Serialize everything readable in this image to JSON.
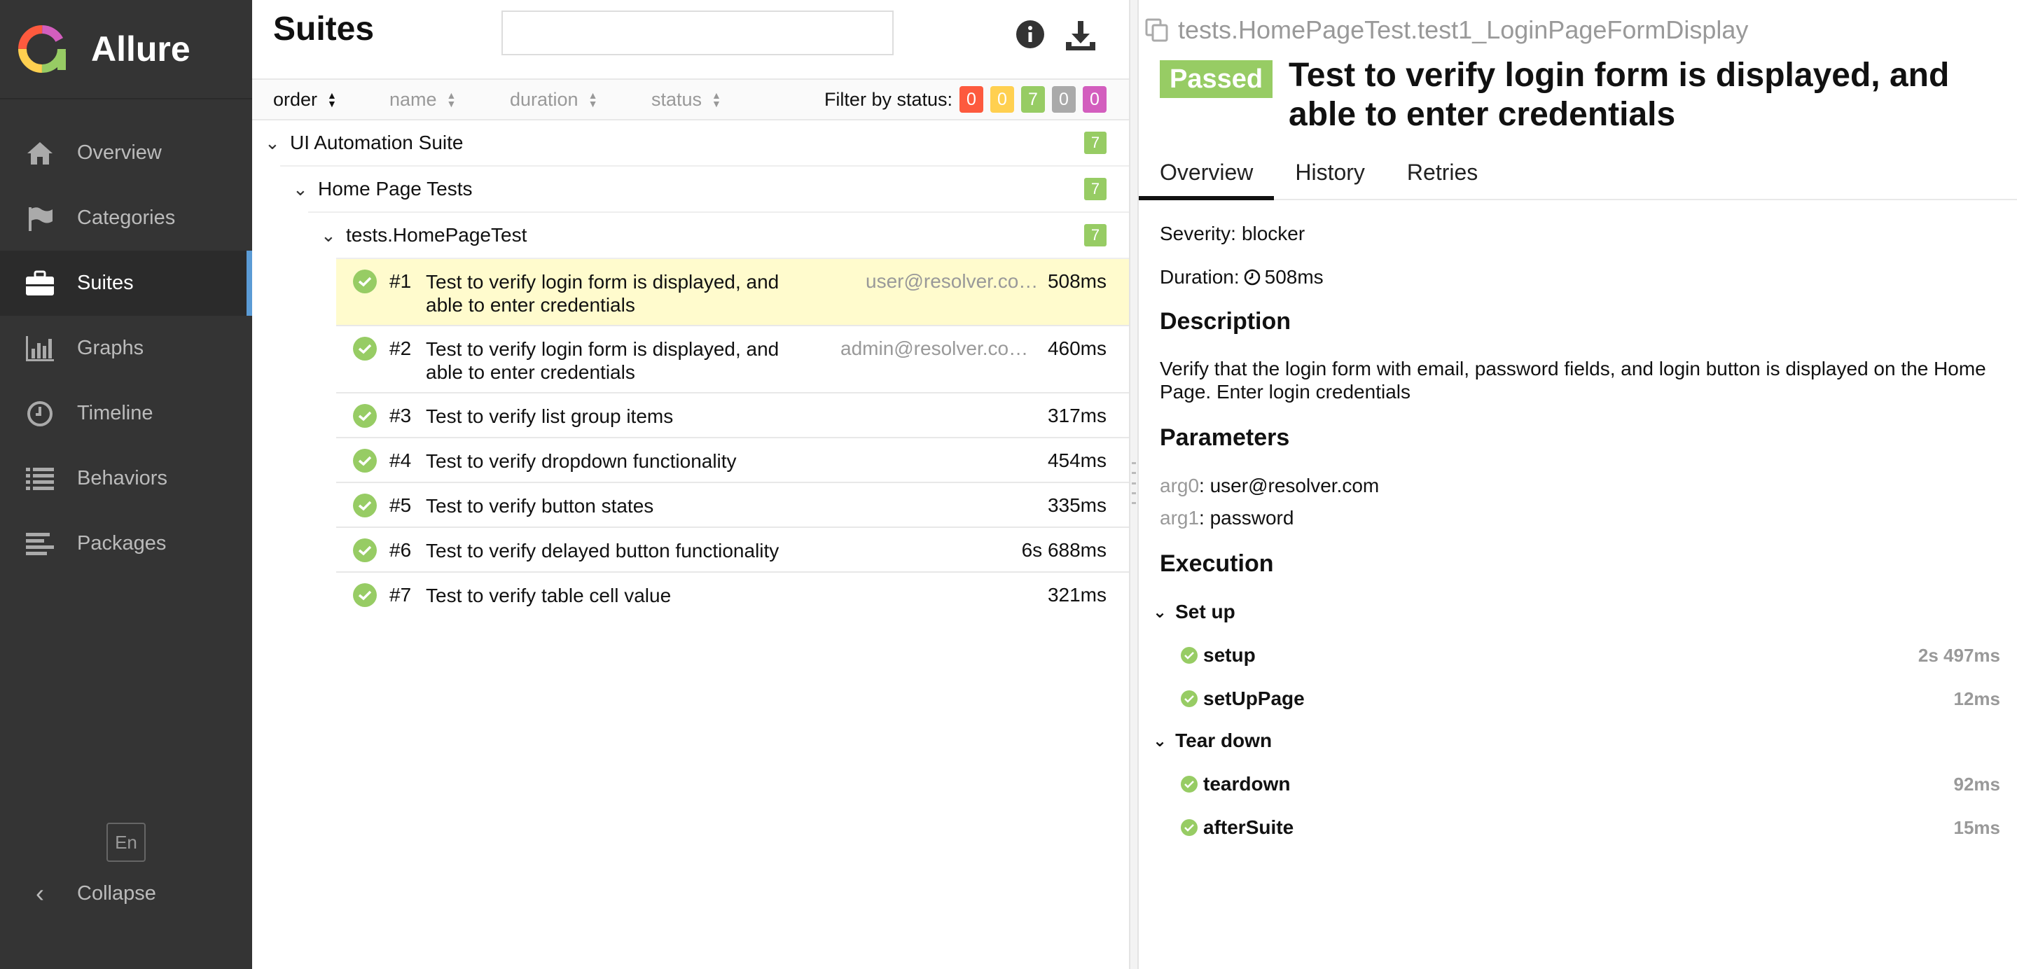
{
  "app": {
    "name": "Allure"
  },
  "sidebar": {
    "items": [
      {
        "label": "Overview",
        "icon": "home-icon"
      },
      {
        "label": "Categories",
        "icon": "flag-icon"
      },
      {
        "label": "Suites",
        "icon": "briefcase-icon",
        "active": true
      },
      {
        "label": "Graphs",
        "icon": "bar-chart-icon"
      },
      {
        "label": "Timeline",
        "icon": "clock-icon"
      },
      {
        "label": "Behaviors",
        "icon": "list-icon"
      },
      {
        "label": "Packages",
        "icon": "align-left-icon"
      }
    ],
    "language": "En",
    "collapse_label": "Collapse"
  },
  "suites": {
    "title": "Suites",
    "search_value": "",
    "sort": {
      "order": "order",
      "name": "name",
      "duration": "duration",
      "status": "status"
    },
    "filter_label": "Filter by status:",
    "filter_counts": [
      {
        "value": "0",
        "color": "#fd5a3e"
      },
      {
        "value": "0",
        "color": "#ffd050"
      },
      {
        "value": "7",
        "color": "#97cc64"
      },
      {
        "value": "0",
        "color": "#aaaaaa"
      },
      {
        "value": "0",
        "color": "#d35ebe"
      }
    ],
    "tree": {
      "suite": {
        "label": "UI Automation Suite",
        "count": "7"
      },
      "group": {
        "label": "Home Page Tests",
        "count": "7"
      },
      "class": {
        "label": "tests.HomePageTest",
        "count": "7"
      }
    },
    "tests": [
      {
        "num": "#1",
        "name": "Test to verify login form is displayed, and able to enter credentials",
        "param": "user@resolver.co…",
        "duration": "508ms"
      },
      {
        "num": "#2",
        "name": "Test to verify login form is displayed, and able to enter credentials",
        "param": "admin@resolver.co…",
        "duration": "460ms"
      },
      {
        "num": "#3",
        "name": "Test to verify list group items",
        "param": "",
        "duration": "317ms"
      },
      {
        "num": "#4",
        "name": "Test to verify dropdown functionality",
        "param": "",
        "duration": "454ms"
      },
      {
        "num": "#5",
        "name": "Test to verify button states",
        "param": "",
        "duration": "335ms"
      },
      {
        "num": "#6",
        "name": "Test to verify delayed button functionality",
        "param": "",
        "duration": "6s 688ms"
      },
      {
        "num": "#7",
        "name": "Test to verify table cell value",
        "param": "",
        "duration": "321ms"
      }
    ]
  },
  "detail": {
    "breadcrumb": "tests.HomePageTest.test1_LoginPageFormDisplay",
    "status": "Passed",
    "title": "Test to verify login form is displayed, and able to enter credentials",
    "tabs": [
      "Overview",
      "History",
      "Retries"
    ],
    "severity_label": "Severity:",
    "severity": "blocker",
    "duration_label": "Duration:",
    "duration": "508ms",
    "description_heading": "Description",
    "description": "Verify that the login form with email, password fields, and login button is displayed on the Home Page. Enter login credentials",
    "parameters_heading": "Parameters",
    "parameters": [
      {
        "key": "arg0",
        "value": "user@resolver.com"
      },
      {
        "key": "arg1",
        "value": "password"
      }
    ],
    "execution_heading": "Execution",
    "setup_label": "Set up",
    "setup_steps": [
      {
        "name": "setup",
        "duration": "2s 497ms"
      },
      {
        "name": "setUpPage",
        "duration": "12ms"
      }
    ],
    "teardown_label": "Tear down",
    "teardown_steps": [
      {
        "name": "teardown",
        "duration": "92ms"
      },
      {
        "name": "afterSuite",
        "duration": "15ms"
      }
    ]
  },
  "colors": {
    "sidebar_bg": "#343434",
    "accent": "#5b9bd5",
    "passed": "#97cc64",
    "selected_row": "#fffbcd"
  }
}
